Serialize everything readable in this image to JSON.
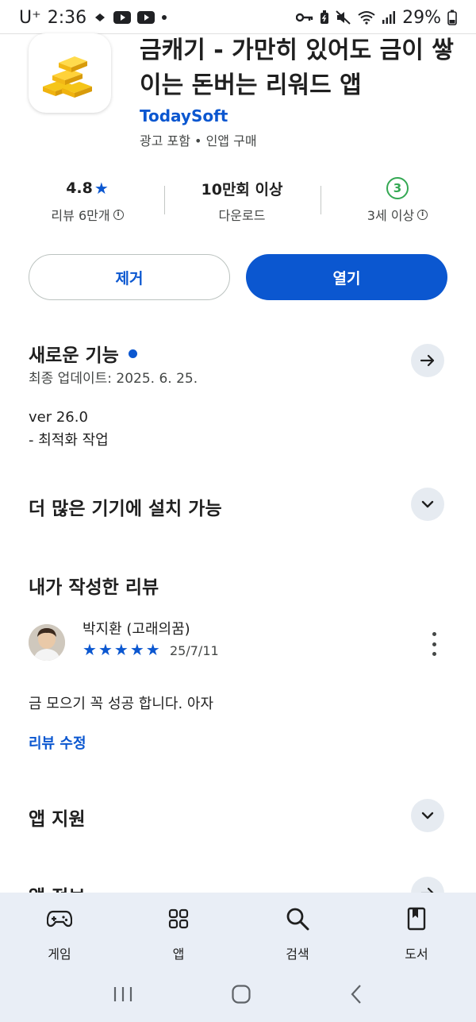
{
  "status_bar": {
    "carrier": "U⁺",
    "time": "2:36",
    "battery": "29%"
  },
  "app": {
    "title": "금캐기 - 가만히 있어도 금이 쌓이는 돈버는 리워드 앱",
    "developer": "TodaySoft",
    "meta": "광고 포함 • 인앱 구매"
  },
  "stats": {
    "rating": "4.8",
    "reviews_label": "리뷰 6만개",
    "downloads": "10만회 이상",
    "downloads_label": "다운로드",
    "age_badge": "3",
    "age_label": "3세 이상"
  },
  "buttons": {
    "remove": "제거",
    "open": "열기"
  },
  "whats_new": {
    "title": "새로운 기능",
    "updated": "최종 업데이트: 2025. 6. 25.",
    "version": "ver 26.0",
    "notes": "- 최적화 작업"
  },
  "more_devices": {
    "title": "더 많은 기기에 설치 가능"
  },
  "my_review": {
    "title": "내가 작성한 리뷰",
    "reviewer": "박지환 (고래의꿈)",
    "stars": 5,
    "date": "25/7/11",
    "text": "금 모으기 꼭 성공 합니다. 아자",
    "edit_label": "리뷰 수정"
  },
  "app_support": {
    "title": "앱 지원"
  },
  "app_info": {
    "title": "앱 정보"
  },
  "bottom_nav": [
    {
      "label": "게임",
      "icon": "gamepad-icon"
    },
    {
      "label": "앱",
      "icon": "apps-icon"
    },
    {
      "label": "검색",
      "icon": "search-icon"
    },
    {
      "label": "도서",
      "icon": "book-icon"
    }
  ],
  "colors": {
    "accent": "#0b57d0",
    "age_green": "#34a853",
    "nav_bg": "#e9eef6"
  }
}
